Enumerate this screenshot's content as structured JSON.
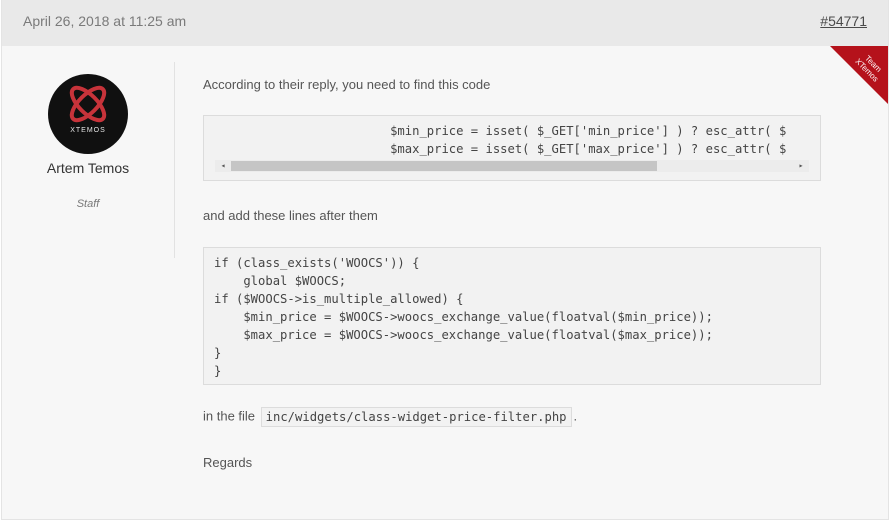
{
  "post": {
    "date": "April 26, 2018 at 11:25 am",
    "permalink": "#54771",
    "ribbon_line1": "Team",
    "ribbon_line2": "XTemos",
    "ribbon_color": "#b5121b"
  },
  "author": {
    "name": "Artem Temos",
    "role": "Staff",
    "avatar_text": "XTEMOS",
    "avatar_accent": "#c7333a"
  },
  "content": {
    "para1": "According to their reply, you need to find this code",
    "code1": [
      "                        $min_price = isset( $_GET['min_price'] ) ? esc_attr( $",
      "                        $max_price = isset( $_GET['max_price'] ) ? esc_attr( $"
    ],
    "para2": "and add these lines after them",
    "code2": [
      "if (class_exists('WOOCS')) {",
      "    global $WOOCS;",
      "if ($WOOCS->is_multiple_allowed) {",
      "    $min_price = $WOOCS->woocs_exchange_value(floatval($min_price));",
      "    $max_price = $WOOCS->woocs_exchange_value(floatval($max_price));",
      "}",
      "}"
    ],
    "para3_before": "in the file",
    "para3_code": "inc/widgets/class-widget-price-filter.php",
    "para3_after": ".",
    "para4": "Regards"
  },
  "icons": {
    "scroll_left": "◂",
    "scroll_right": "▸"
  }
}
